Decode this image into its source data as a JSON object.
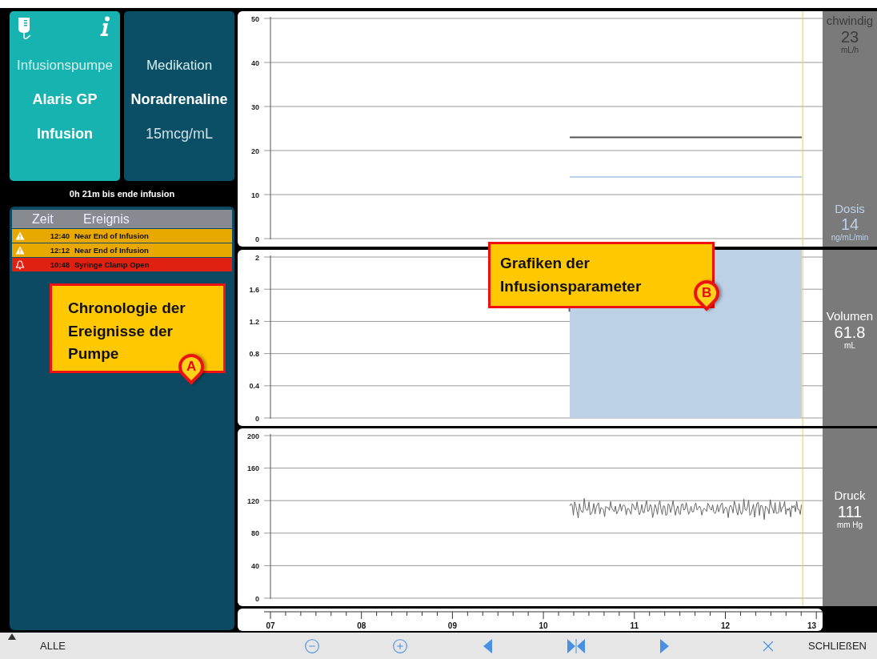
{
  "infusion_tile": {
    "label": "Infusionspumpe",
    "device": "Alaris GP",
    "mode": "Infusion"
  },
  "medication_tile": {
    "label": "Medikation",
    "drug": "Noradrenaline",
    "concentration": "15mcg/mL"
  },
  "remaining": "0h 21m bis ende infusion",
  "events": {
    "columns": [
      "Zeit",
      "Ereignis"
    ],
    "rows": [
      {
        "kind": "warning",
        "time": "12:40",
        "event": "Near End of Infusion"
      },
      {
        "kind": "warning",
        "time": "12:12",
        "event": "Near End of Infusion"
      },
      {
        "kind": "alarm",
        "time": "10:48",
        "event": "Syringe Clamp Open"
      }
    ]
  },
  "charts": [
    {
      "kind": "rate-dose",
      "y_labels": [
        "50",
        "40",
        "30",
        "20",
        "10",
        "0"
      ],
      "readings": [
        {
          "label": "chwindig",
          "value": "23",
          "unit": "mL/h",
          "color": "#3c3c3c"
        },
        {
          "label": "Dosis",
          "value": "14",
          "unit": "ng/mL/min",
          "color": "#bcd0ea"
        }
      ]
    },
    {
      "kind": "volume",
      "y_labels": [
        "2",
        "1.6",
        "1.2",
        "0.8",
        "0.4",
        "0"
      ],
      "readings": [
        {
          "label": "Volumen",
          "value": "61.8",
          "unit": "mL",
          "color": "#ffffff"
        }
      ]
    },
    {
      "kind": "pressure",
      "y_labels": [
        "200",
        "160",
        "120",
        "80",
        "40",
        "0"
      ],
      "readings": [
        {
          "label": "Druck",
          "value": "111",
          "unit": "mm Hg",
          "color": "#ffffff"
        }
      ]
    }
  ],
  "timeline": {
    "labels": [
      "07",
      "08",
      "09",
      "10",
      "11",
      "12",
      "13"
    ]
  },
  "toolbar": {
    "left": "ALLE",
    "buttons": [
      {
        "kind": "zoom-out"
      },
      {
        "kind": "zoom-in"
      },
      {
        "kind": "back"
      },
      {
        "kind": "fit"
      },
      {
        "kind": "forward"
      },
      {
        "kind": "clear"
      }
    ],
    "close": "SCHLIEßEN"
  },
  "callouts": [
    {
      "text": "Chronologie der Ereignisse der Pumpe",
      "marker": "A"
    },
    {
      "text": "Grafiken der Infusionsparameter",
      "marker": "B"
    }
  ]
}
